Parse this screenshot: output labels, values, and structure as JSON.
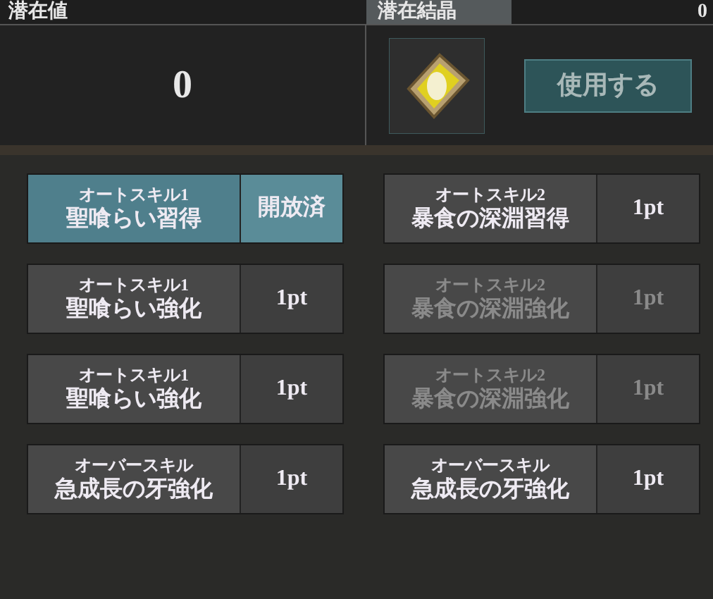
{
  "potential": {
    "label": "潜在値",
    "value": "0"
  },
  "crystal": {
    "label": "潜在結晶",
    "count": "0",
    "button": "使用する"
  },
  "skills": [
    {
      "category": "オートスキル1",
      "name": "聖喰らい習得",
      "cost": "開放済",
      "selected": true,
      "disabled": false
    },
    {
      "category": "オートスキル2",
      "name": "暴食の深淵習得",
      "cost": "1pt",
      "selected": false,
      "disabled": false
    },
    {
      "category": "オートスキル1",
      "name": "聖喰らい強化",
      "cost": "1pt",
      "selected": false,
      "disabled": false
    },
    {
      "category": "オートスキル2",
      "name": "暴食の深淵強化",
      "cost": "1pt",
      "selected": false,
      "disabled": true
    },
    {
      "category": "オートスキル1",
      "name": "聖喰らい強化",
      "cost": "1pt",
      "selected": false,
      "disabled": false
    },
    {
      "category": "オートスキル2",
      "name": "暴食の深淵強化",
      "cost": "1pt",
      "selected": false,
      "disabled": true
    },
    {
      "category": "オーバースキル",
      "name": "急成長の牙強化",
      "cost": "1pt",
      "selected": false,
      "disabled": false
    },
    {
      "category": "オーバースキル",
      "name": "急成長の牙強化",
      "cost": "1pt",
      "selected": false,
      "disabled": false
    }
  ]
}
